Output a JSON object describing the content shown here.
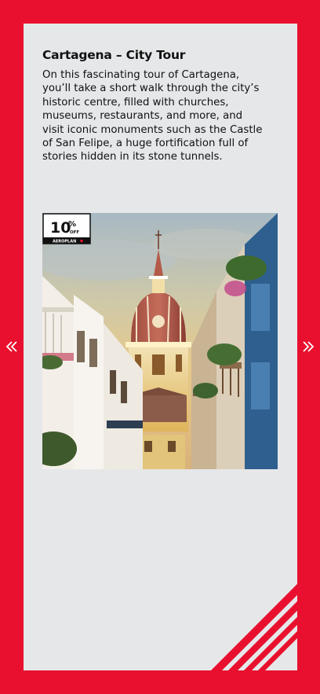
{
  "tour": {
    "title": "Cartagena – City Tour",
    "description": "On this fascinating tour of Cartagena, you’ll take a short walk through the city’s historic centre, filled with churches, museums, restaurants, and more, and visit iconic monuments such as the Castle of San Felipe, a huge fortification full of stories hidden in its stone tunnels."
  },
  "badge": {
    "discount": "10",
    "percent_sign": "%",
    "off_label": "OFF",
    "brand": "AEROPLAN"
  },
  "nav": {
    "prev_icon": "double-chevron-left-icon",
    "next_icon": "double-chevron-right-icon"
  },
  "colors": {
    "brand_red": "#e8102e",
    "card_bg": "#e6e7e9",
    "text": "#111111"
  }
}
